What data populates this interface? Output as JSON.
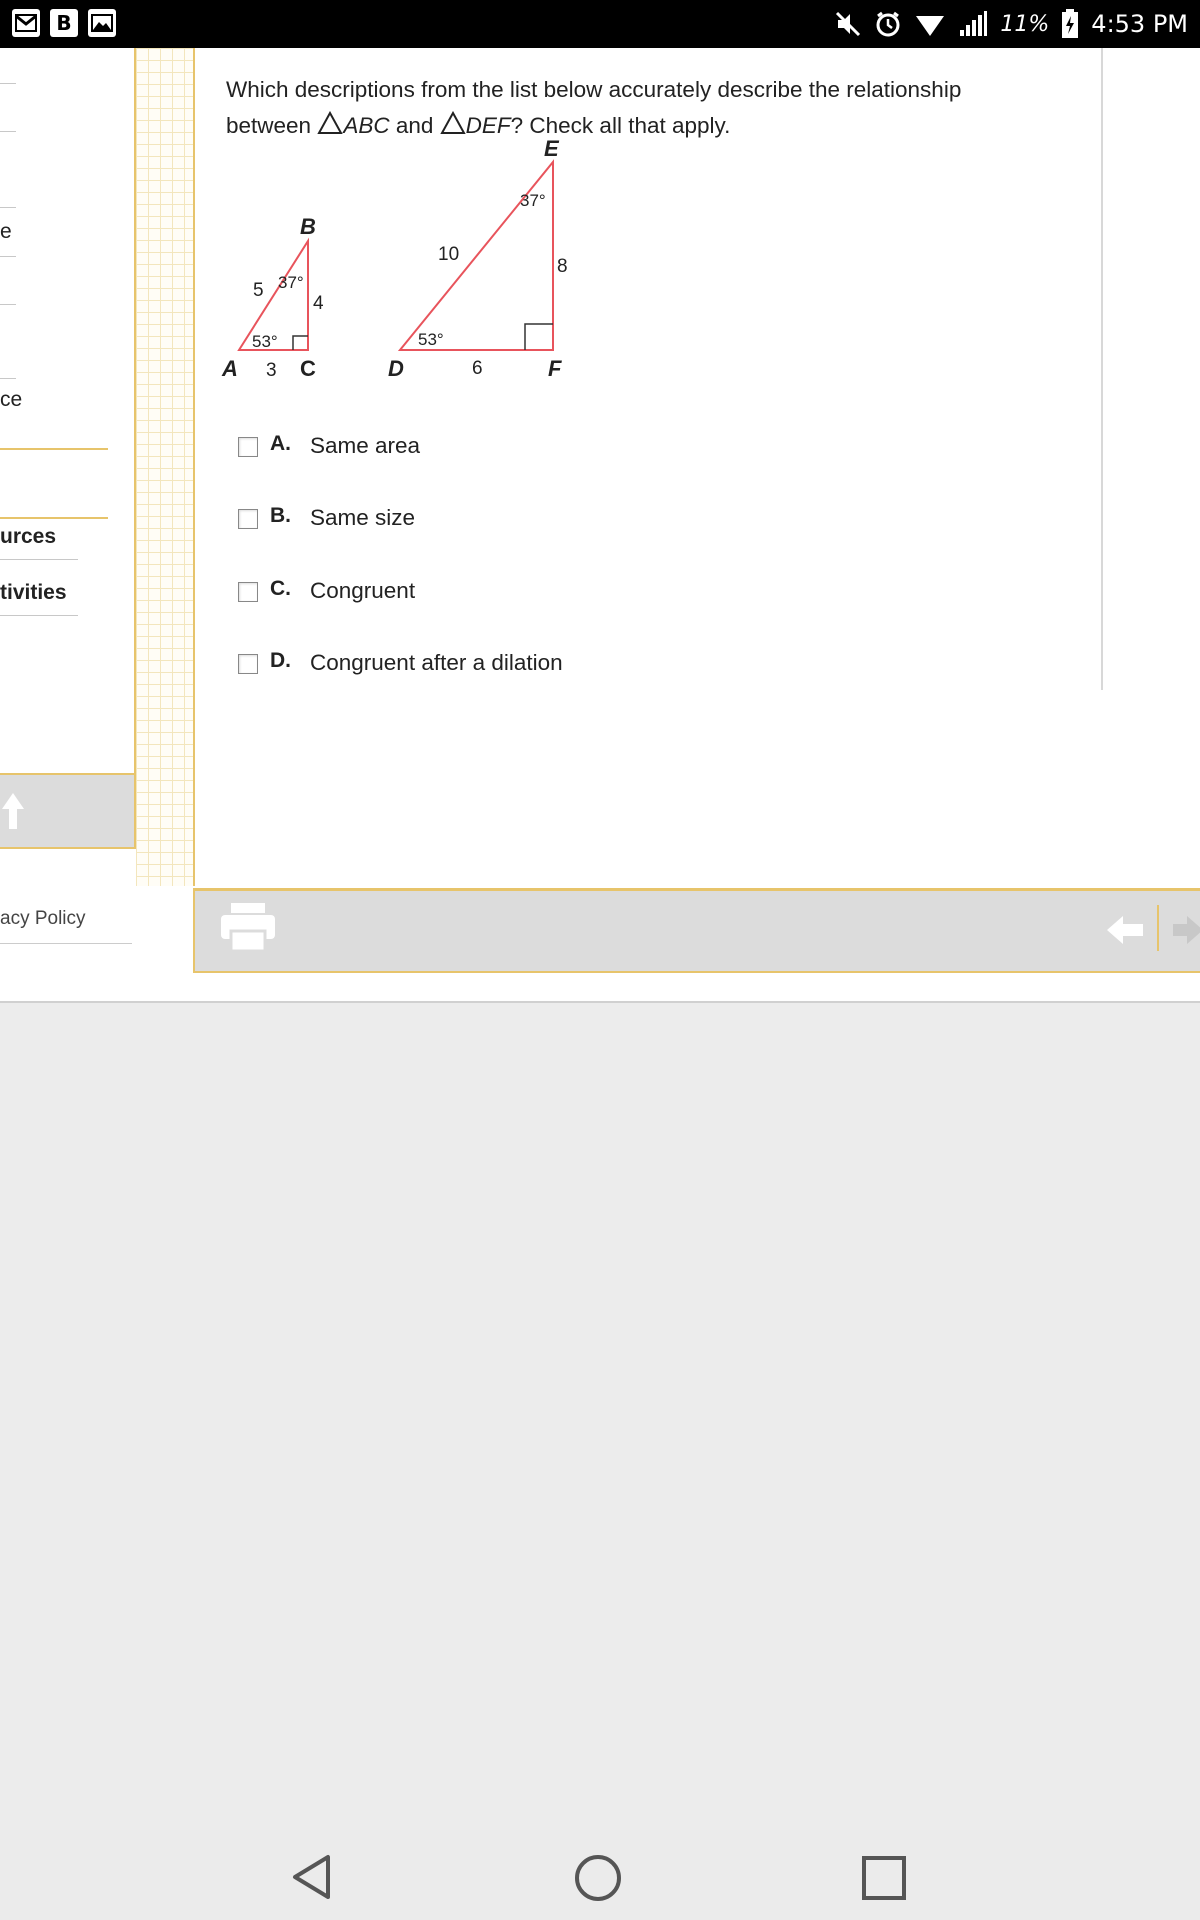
{
  "status_bar": {
    "left_icons": [
      "gmail-icon",
      "b-app-icon",
      "gallery-icon"
    ],
    "right_icons": [
      "mute-icon",
      "alarm-icon",
      "wifi-icon",
      "signal-icon",
      "battery-charging-icon"
    ],
    "battery_percent": "11%",
    "time": "4:53 PM"
  },
  "sidebar": {
    "items": [
      {
        "label": "e"
      },
      {
        "label": "ce"
      },
      {
        "label": "urces"
      },
      {
        "label": "tivities"
      }
    ],
    "footer_link": "acy Policy"
  },
  "question": {
    "text_before": "Which descriptions from the list below accurately describe the relationship between ",
    "triangle1": "ABC",
    "and": " and ",
    "triangle2": "DEF",
    "text_after": "? Check all that apply."
  },
  "diagram": {
    "small_triangle": {
      "vertices": {
        "A": "A",
        "B": "B",
        "C": "C"
      },
      "side_AB": "5",
      "side_BC": "4",
      "side_AC": "3",
      "angle_A": "53°",
      "angle_B": "37°"
    },
    "large_triangle": {
      "vertices": {
        "D": "D",
        "E": "E",
        "F": "F"
      },
      "side_DE": "10",
      "side_EF": "8",
      "side_DF": "6",
      "angle_D": "53°",
      "angle_E": "37°"
    }
  },
  "choices": [
    {
      "letter": "A.",
      "label": "Same area",
      "checked": false
    },
    {
      "letter": "B.",
      "label": "Same size",
      "checked": false
    },
    {
      "letter": "C.",
      "label": "Congruent",
      "checked": false
    },
    {
      "letter": "D.",
      "label": "Congruent after a dilation",
      "checked": false
    }
  ],
  "toolbar": {
    "print_icon": "printer-icon",
    "prev_icon": "arrow-left-icon",
    "next_icon": "arrow-right-icon"
  },
  "navbar": {
    "back_icon": "back-triangle-icon",
    "home_icon": "home-circle-icon",
    "recents_icon": "recents-square-icon"
  }
}
